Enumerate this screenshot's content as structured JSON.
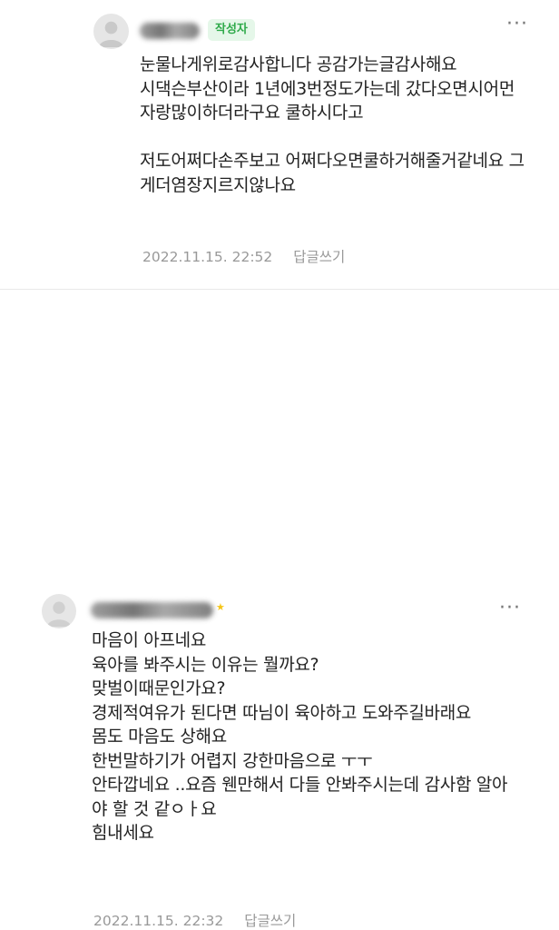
{
  "comments": [
    {
      "author_badge": "작성자",
      "body": "눈물나게위로감사합니다 공감가는글감사해요\n시댁슨부산이라 1년에3번정도가는데 갔다오면시어먼자랑많이하더라구요 쿨하시다고\n\n저도어쩌다손주보고 어쩌다오면쿨하거해줄거같네요 그게더염장지르지않나요",
      "timestamp": "2022.11.15. 22:52",
      "reply_label": "답글쓰기",
      "more_label": "···"
    },
    {
      "body": "마음이 아프네요\n육아를 봐주시는 이유는 뭘까요?\n맞벌이때문인가요?\n경제적여유가 된다면 따님이 육아하고 도와주길바래요\n몸도 마음도 상해요\n한번말하기가 어렵지 강한마음으로 ㅜㅜ\n안타깝네요 ..요즘 웬만해서 다들 안봐주시는데 감사함 알아야 할 것 같ㅇㅏ요\n힘내세요",
      "timestamp": "2022.11.15. 22:32",
      "reply_label": "답글쓰기",
      "more_label": "···",
      "star_icon": "★"
    }
  ],
  "colors": {
    "badge_bg": "#e5f7e9",
    "badge_text": "#2faa4a",
    "meta_text": "#999999",
    "body_text": "#222222"
  }
}
